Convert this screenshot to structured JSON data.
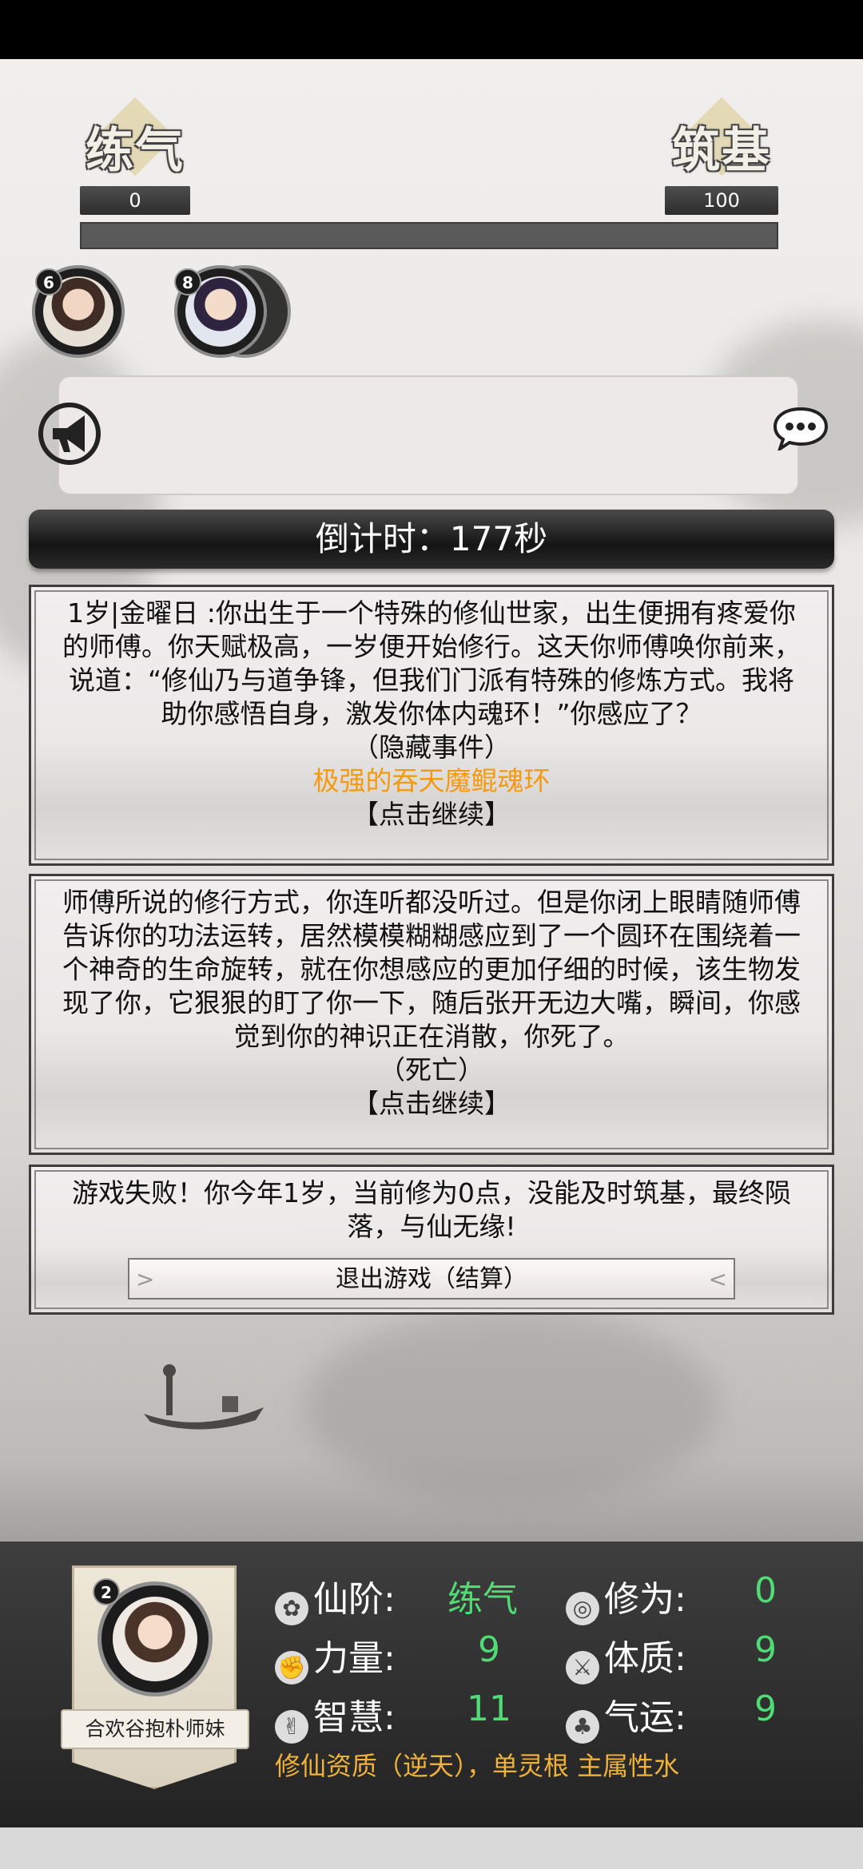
{
  "realm_left": {
    "name": "练气",
    "value": "0"
  },
  "realm_right": {
    "name": "筑基",
    "value": "100"
  },
  "cultivation_progress": 0,
  "companions": [
    {
      "badge": "6"
    },
    {
      "badge": "8"
    }
  ],
  "countdown": "倒计时：177秒",
  "events": [
    {
      "text": "1岁|金曜日 :你出生于一个特殊的修仙世家，出生便拥有疼爱你的师傅。你天赋极高，一岁便开始修行。这天你师傅唤你前来，说道：“修仙乃与道争锋，但我们门派有特殊的修炼方式。我将助你感悟自身，激发你体内魂环！”你感应了？",
      "tag": "（隐藏事件）",
      "highlight": "极强的吞天魔鲲魂环",
      "continue": "【点击继续】"
    },
    {
      "text": "师傅所说的修行方式，你连听都没听过。但是你闭上眼睛随师傅告诉你的功法运转，居然模模糊糊感应到了一个圆环在围绕着一个神奇的生命旋转，就在你想感应的更加仔细的时候，该生物发现了你，它狠狠的盯了你一下，随后张开无边大嘴，瞬间，你感觉到你的神识正在消散，你死了。",
      "tag": "（死亡）",
      "continue": "【点击继续】"
    }
  ],
  "result": {
    "text": "游戏失败！你今年1岁，当前修为0点，没能及时筑基，最终陨落，与仙无缘!",
    "exit_button": "退出游戏（结算）"
  },
  "player": {
    "badge": "2",
    "name": "合欢谷抱朴师妹",
    "stats": {
      "rank_label": "仙阶:",
      "rank_value": "练气",
      "cultivation_label": "修为:",
      "cultivation_value": "0",
      "strength_label": "力量:",
      "strength_value": "9",
      "constitution_label": "体质:",
      "constitution_value": "9",
      "wisdom_label": "智慧:",
      "wisdom_value": "11",
      "luck_label": "气运:",
      "luck_value": "9"
    },
    "talent": "修仙资质（逆天），单灵根 主属性水"
  },
  "colors": {
    "accent_green": "#4fdc74",
    "highlight_orange": "#f39a12",
    "talent_gold": "#f0b23a"
  }
}
